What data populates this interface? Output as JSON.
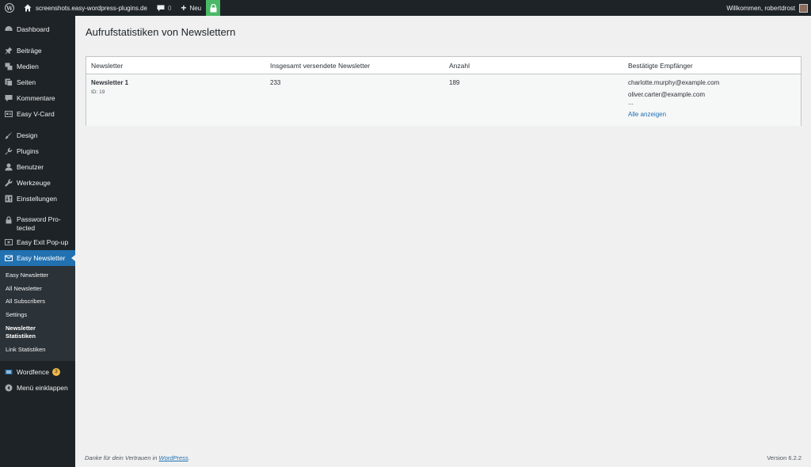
{
  "adminbar": {
    "site_name": "screenshots.easy-wordpress-plugins.de",
    "comments_count": "0",
    "new_label": "Neu",
    "welcome": "Willkommen, robertdrost"
  },
  "sidebar": {
    "items": [
      {
        "label": "Dashboard",
        "icon": "dashboard-icon"
      },
      {
        "label": "Beiträge",
        "icon": "pin-icon"
      },
      {
        "label": "Medien",
        "icon": "media-icon"
      },
      {
        "label": "Seiten",
        "icon": "pages-icon"
      },
      {
        "label": "Kommentare",
        "icon": "comment-icon"
      },
      {
        "label": "Easy V-Card",
        "icon": "vcard-icon"
      },
      {
        "label": "Design",
        "icon": "brush-icon"
      },
      {
        "label": "Plugins",
        "icon": "plugin-icon"
      },
      {
        "label": "Benutzer",
        "icon": "user-icon"
      },
      {
        "label": "Werkzeuge",
        "icon": "wrench-icon"
      },
      {
        "label": "Einstellungen",
        "icon": "settings-icon"
      },
      {
        "label": "Password Pro-tected",
        "icon": "lock-icon"
      },
      {
        "label": "Easy Exit Pop-up",
        "icon": "popup-icon"
      },
      {
        "label": "Easy Newsletter",
        "icon": "mail-icon"
      },
      {
        "label": "Wordfence",
        "icon": "wordfence-icon",
        "badge": "3"
      },
      {
        "label": "Menü einklappen",
        "icon": "collapse-icon"
      }
    ],
    "submenu": [
      "Easy Newsletter",
      "All Newsletter",
      "All Subscribers",
      "Settings",
      "Newsletter Statistiken",
      "Link Statistiken"
    ]
  },
  "main": {
    "title": "Aufrufstatistiken von Newslettern",
    "table": {
      "headers": [
        "Newsletter",
        "Insgesamt versendete Newsletter",
        "Anzahl",
        "Bestätigte Empfänger"
      ],
      "rows": [
        {
          "name": "Newsletter 1",
          "id": "ID: 19",
          "total": "233",
          "count": "189",
          "recipients": [
            "charlotte.murphy@example.com",
            "oliver.carter@example.com"
          ],
          "ellipsis": "...",
          "show_all": "Alle anzeigen"
        }
      ]
    }
  },
  "footer": {
    "thanks_prefix": "Danke für dein Vertrauen in",
    "thanks_link": "WordPress",
    "thanks_suffix": ".",
    "version": "Version 6.2.2"
  },
  "colors": {
    "sidebar_bg": "#1d2327",
    "accent": "#2271b1",
    "lock_green": "#4ab866",
    "badge": "#f0b849"
  }
}
